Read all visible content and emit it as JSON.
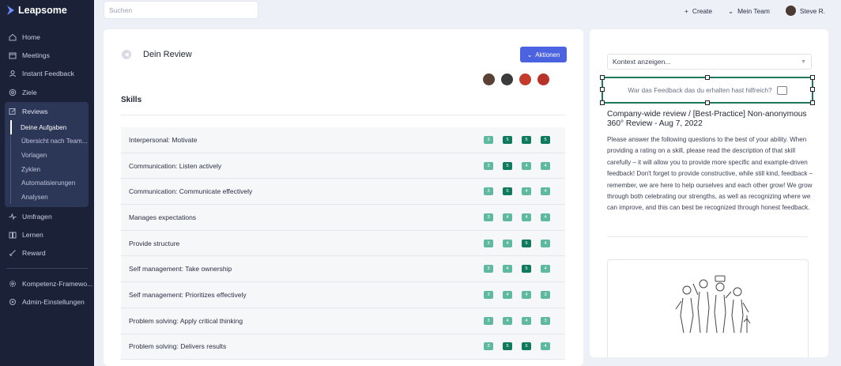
{
  "app": {
    "logo_text": "Leapsome"
  },
  "sidebar": {
    "items": [
      {
        "label": "Home",
        "icon": "home-icon"
      },
      {
        "label": "Meetings",
        "icon": "calendar-icon"
      },
      {
        "label": "Instant Feedback",
        "icon": "user-icon"
      },
      {
        "label": "Ziele",
        "icon": "target-icon"
      }
    ],
    "reviews": {
      "label": "Reviews",
      "icon": "edit-icon",
      "sub_items": [
        {
          "label": "Deine Aufgaben",
          "active": true
        },
        {
          "label": "Übersicht nach Team..."
        },
        {
          "label": "Vorlagen"
        },
        {
          "label": "Zyklen"
        },
        {
          "label": "Automatisierungen"
        },
        {
          "label": "Analysen"
        }
      ]
    },
    "items_after": [
      {
        "label": "Umfragen",
        "icon": "pulse-icon"
      },
      {
        "label": "Lernen",
        "icon": "book-icon"
      },
      {
        "label": "Reward",
        "icon": "rocket-icon"
      }
    ],
    "items_bottom": [
      {
        "label": "Kompetenz-Framewo...",
        "icon": "gear-icon"
      },
      {
        "label": "Admin-Einstellungen",
        "icon": "settings-icon"
      }
    ]
  },
  "topbar": {
    "search_placeholder": "Suchen",
    "create_label": "Create",
    "team_label": "Mein Team",
    "user_name": "Steve R."
  },
  "main": {
    "title": "Dein Review",
    "actions_label": "Aktionen",
    "section_title": "Skills",
    "colors": {
      "light": "#5fb9a0",
      "dark": "#0f7a5d"
    },
    "rows": [
      {
        "label": "Interpersonal: Motivate",
        "ratings": [
          3,
          5,
          5,
          5
        ]
      },
      {
        "label": "Communication: Listen actively",
        "ratings": [
          3,
          5,
          4,
          4
        ]
      },
      {
        "label": "Communication: Communicate effectively",
        "ratings": [
          3,
          5,
          4,
          4
        ]
      },
      {
        "label": "Manages expectations",
        "ratings": [
          3,
          4,
          4,
          4
        ]
      },
      {
        "label": "Provide structure",
        "ratings": [
          3,
          4,
          5,
          4
        ]
      },
      {
        "label": "Self management: Take ownership",
        "ratings": [
          3,
          4,
          5,
          4
        ]
      },
      {
        "label": "Self management: Prioritizes effectively",
        "ratings": [
          3,
          4,
          4,
          3
        ]
      },
      {
        "label": "Problem solving: Apply critical thinking",
        "ratings": [
          3,
          4,
          4,
          3
        ]
      },
      {
        "label": "Problem solving: Delivers results",
        "ratings": [
          3,
          5,
          5,
          4
        ]
      }
    ]
  },
  "panel": {
    "context_label": "Kontext anzeigen...",
    "feedback_prompt": "War das Feedback das du erhalten hast hilfreich?",
    "review_title": "Company-wide review / [Best-Practice] Non-anonymous 360° Review - Aug 7, 2022",
    "review_body": "Please answer the following questions to the best of your ability. When providing a rating on a skill, please read the description of that skill carefully – it will allow you to provide more specific and example-driven feedback! Don't forget to provide constructive, while still kind, feedback – remember, we are here to help ourselves and each other grow! We grow through both celebrating our strengths, as well as recognizing where we can improve, and this can best be recognized through honest feedback."
  }
}
